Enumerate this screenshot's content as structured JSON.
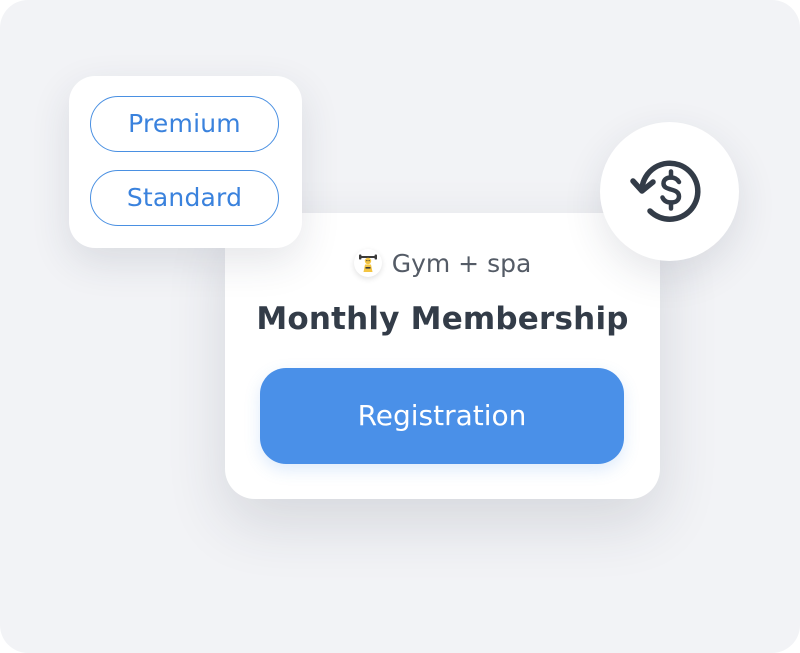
{
  "plans": {
    "options": [
      {
        "label": "Premium"
      },
      {
        "label": "Standard"
      }
    ],
    "accent_color": "#4a90e2"
  },
  "membership": {
    "brand_name": "Gym + spa",
    "brand_icon": "gym-mascot-logo",
    "title": "Monthly Membership",
    "cta_label": "Registration",
    "cta_color": "#4a90e8"
  },
  "badge": {
    "icon": "refund-dollar-icon"
  }
}
